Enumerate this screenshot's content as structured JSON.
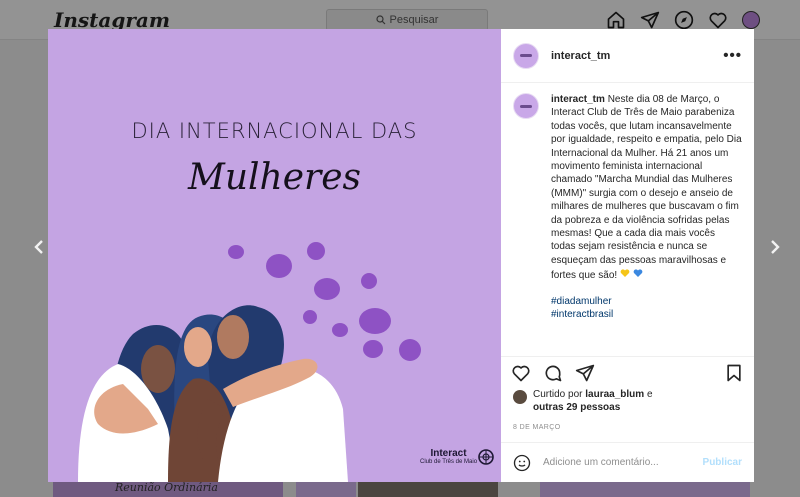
{
  "app": {
    "logo": "Instagram",
    "search_placeholder": "Pesquisar"
  },
  "post": {
    "image": {
      "title_line1": "DIA INTERNACIONAL DAS",
      "title_line2": "Mulheres",
      "brand_name": "Interact",
      "brand_sub": "Club de Três de Maio",
      "background_color": "#c4a4e3"
    },
    "header": {
      "username": "interact_tm",
      "more_label": "•••"
    },
    "caption": {
      "username": "interact_tm",
      "text": "Neste dia 08 de Março, o Interact Club de Três de Maio parabeniza todas vocês, que lutam incansavelmente por igualdade, respeito e empatia, pelo Dia Internacional da Mulher. Há 21 anos um movimento feminista internacional chamado \"Marcha Mundial das Mulheres (MMM)\" surgia com o desejo e anseio de milhares de mulheres que buscavam o fim da pobreza e da violência sofridas pelas mesmas! Que a cada dia mais vocês todas sejam resistência e nunca se esqueçam das pessoas maravilhosas e fortes que são!",
      "hashtags": [
        "#diadamulher",
        "#interactbrasil"
      ]
    },
    "likes": {
      "prefix": "Curtido por",
      "user": "lauraa_blum",
      "connector": "e",
      "others": "outras 29 pessoas"
    },
    "date": "8 DE MARÇO",
    "comment_placeholder": "Adicione um comentário...",
    "publish_label": "Publicar"
  },
  "background": {
    "caption": "Reunião Ordinária"
  }
}
